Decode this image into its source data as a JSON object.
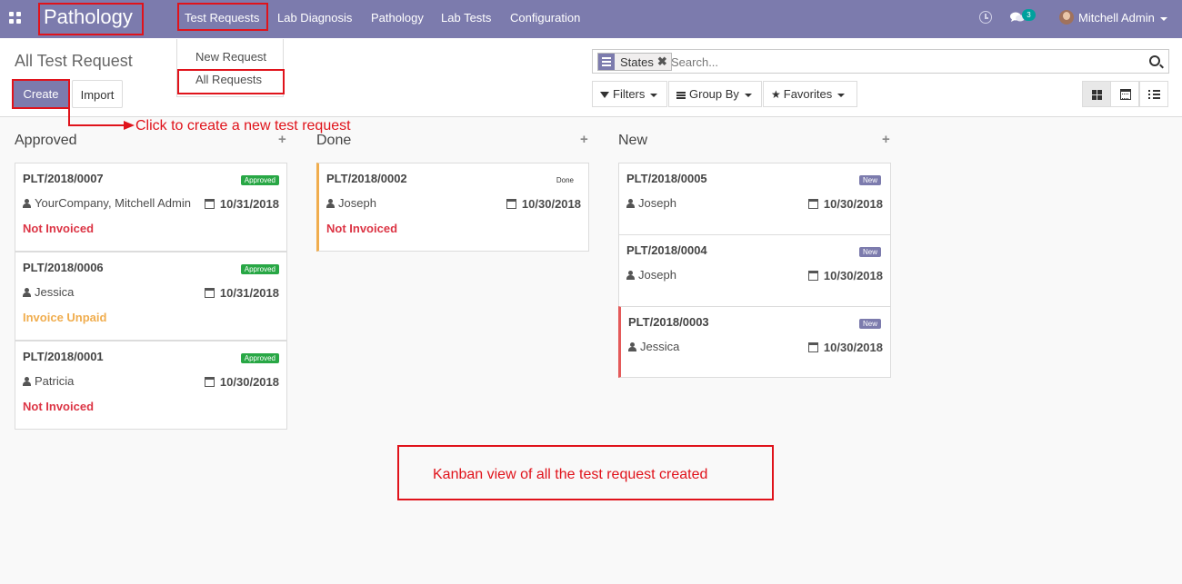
{
  "navbar": {
    "app_name": "Pathology",
    "menu": [
      {
        "label": "Test Requests"
      },
      {
        "label": "Lab Diagnosis"
      },
      {
        "label": "Pathology"
      },
      {
        "label": "Lab Tests"
      },
      {
        "label": "Configuration"
      }
    ],
    "chat_badge_count": "3",
    "user_name": "Mitchell Admin"
  },
  "dropdown": {
    "items": [
      {
        "label": "New Request"
      },
      {
        "label": "All Requests"
      }
    ]
  },
  "control_panel": {
    "title": "All Test Request",
    "create_label": "Create",
    "import_label": "Import",
    "search": {
      "facet_label": "States",
      "placeholder": "Search..."
    },
    "filters_label": "Filters",
    "group_by_label": "Group By",
    "favorites_label": "Favorites"
  },
  "kanban": {
    "columns": [
      {
        "title": "Approved",
        "cards": [
          {
            "ref": "PLT/2018/0007",
            "badge": "Approved",
            "person": "YourCompany, Mitchell Admin",
            "date": "10/31/2018",
            "status": "Not Invoiced"
          },
          {
            "ref": "PLT/2018/0006",
            "badge": "Approved",
            "person": "Jessica",
            "date": "10/31/2018",
            "status": "Invoice Unpaid"
          },
          {
            "ref": "PLT/2018/0001",
            "badge": "Approved",
            "person": "Patricia",
            "date": "10/30/2018",
            "status": "Not Invoiced"
          }
        ]
      },
      {
        "title": "Done",
        "cards": [
          {
            "ref": "PLT/2018/0002",
            "badge": "Done",
            "person": "Joseph",
            "date": "10/30/2018",
            "status": "Not Invoiced"
          }
        ]
      },
      {
        "title": "New",
        "cards": [
          {
            "ref": "PLT/2018/0005",
            "badge": "New",
            "person": "Joseph",
            "date": "10/30/2018"
          },
          {
            "ref": "PLT/2018/0004",
            "badge": "New",
            "person": "Joseph",
            "date": "10/30/2018"
          },
          {
            "ref": "PLT/2018/0003",
            "badge": "New",
            "person": "Jessica",
            "date": "10/30/2018"
          }
        ]
      }
    ]
  },
  "annotations": {
    "create_hint": "Click to create a new test request",
    "kanban_hint": "Kanban view of all the test request created"
  },
  "colors": {
    "brand": "#7c7bad",
    "approved": "#28a745",
    "not_invoiced": "#dc3545",
    "invoice_unpaid": "#f0ad4e",
    "annotation": "#e0131b"
  }
}
